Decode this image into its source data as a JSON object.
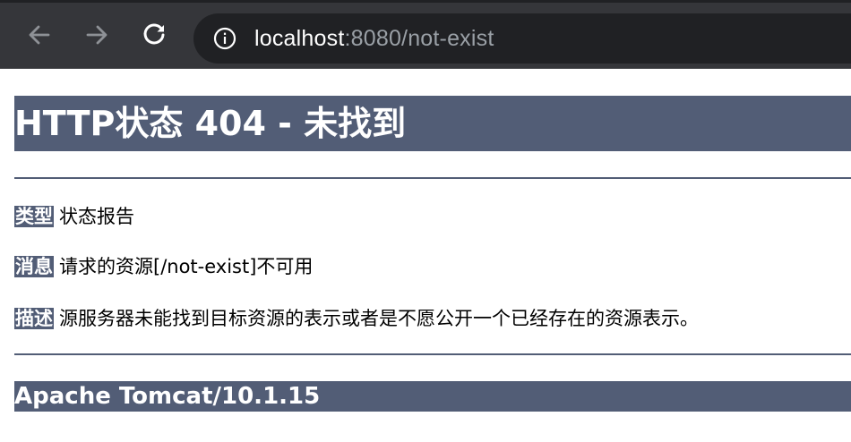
{
  "browser": {
    "url_host": "localhost",
    "url_rest": ":8080/not-exist",
    "icons": {
      "back": "arrow-left-icon",
      "forward": "arrow-right-icon",
      "reload": "reload-icon",
      "info": "info-icon"
    }
  },
  "page": {
    "title": "HTTP状态 404 - 未找到",
    "rows": [
      {
        "label": "类型",
        "value": "状态报告"
      },
      {
        "label": "消息",
        "value": "请求的资源[/not-exist]不可用"
      },
      {
        "label": "描述",
        "value": "源服务器未能找到目标资源的表示或者是不愿公开一个已经存在的资源表示。"
      }
    ],
    "footer": "Apache Tomcat/10.1.15"
  },
  "colors": {
    "header_bg": "#525d76",
    "chrome_bg": "#35363a",
    "omnibox_bg": "#202124"
  }
}
